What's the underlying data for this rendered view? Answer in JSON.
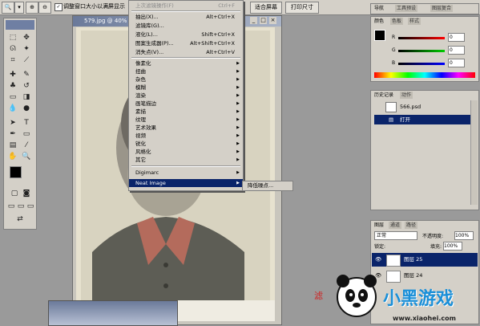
{
  "options_bar": {
    "checkbox_label": "调整窗口大小以满屏显示",
    "fit_screen": "适合屏幕",
    "print_size": "打印尺寸"
  },
  "document": {
    "title": "579.jpg @ 40% (图..."
  },
  "filter_menu": {
    "items": [
      {
        "label": "上次滤镜操作(F)",
        "shortcut": "Ctrl+F",
        "disabled": true
      },
      {
        "label": "抽出(X)...",
        "shortcut": "Alt+Ctrl+X"
      },
      {
        "label": "滤镜库(G)...",
        "shortcut": ""
      },
      {
        "label": "液化(L)...",
        "shortcut": "Shift+Ctrl+X"
      },
      {
        "label": "图案生成器(P)...",
        "shortcut": "Alt+Shift+Ctrl+X"
      },
      {
        "label": "消失点(V)...",
        "shortcut": "Alt+Ctrl+V"
      },
      {
        "label": "像素化",
        "submenu": true
      },
      {
        "label": "扭曲",
        "submenu": true
      },
      {
        "label": "杂色",
        "submenu": true
      },
      {
        "label": "模糊",
        "submenu": true
      },
      {
        "label": "渲染",
        "submenu": true
      },
      {
        "label": "画笔描边",
        "submenu": true
      },
      {
        "label": "素描",
        "submenu": true
      },
      {
        "label": "纹理",
        "submenu": true
      },
      {
        "label": "艺术效果",
        "submenu": true
      },
      {
        "label": "视频",
        "submenu": true
      },
      {
        "label": "锐化",
        "submenu": true
      },
      {
        "label": "风格化",
        "submenu": true
      },
      {
        "label": "其它",
        "submenu": true
      },
      {
        "label": "Digimarc",
        "submenu": true
      },
      {
        "label": "Neat Image",
        "submenu": true,
        "highlighted": true
      }
    ],
    "submenu_item": "降低噪点..."
  },
  "navigator_panel": {
    "tabs": [
      "导航",
      "工具预设",
      "图层复合"
    ]
  },
  "color_panel": {
    "tabs": [
      "颜色",
      "色板",
      "样式"
    ],
    "channels": [
      {
        "name": "R",
        "value": "0",
        "color": "#d02020"
      },
      {
        "name": "G",
        "value": "0",
        "color": "#20a020"
      },
      {
        "name": "B",
        "value": "0",
        "color": "#2040d0"
      }
    ]
  },
  "history_panel": {
    "tabs": [
      "历史记录",
      "动作"
    ],
    "snapshot": "566.psd",
    "state": "打开"
  },
  "layers_panel": {
    "tabs": [
      "图层",
      "通道",
      "路径"
    ],
    "blend_mode": "正常",
    "opacity_label": "不透明度:",
    "opacity_value": "100%",
    "lock_label": "锁定:",
    "fill_label": "填充:",
    "fill_value": "100%",
    "layers": [
      "图层 25",
      "图层 24"
    ]
  },
  "watermark": {
    "site": "小黑游戏",
    "url": "www.xiaohei.com",
    "red_text": "滤"
  }
}
